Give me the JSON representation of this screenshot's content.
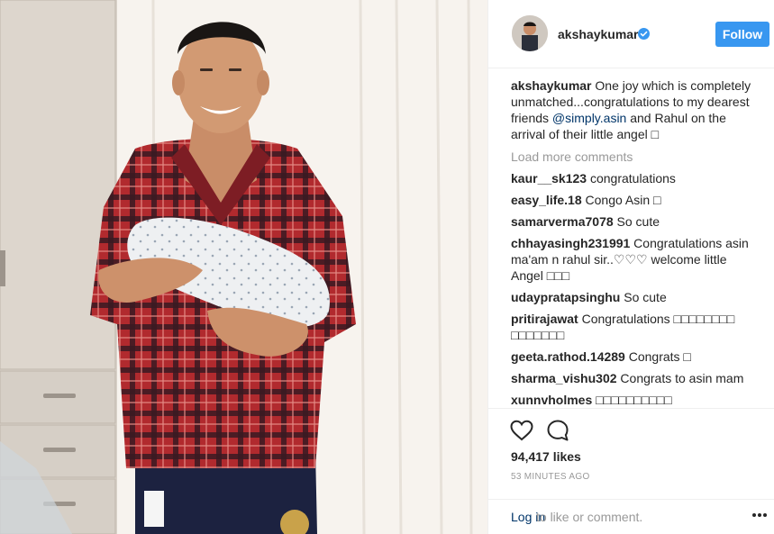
{
  "post": {
    "username": "akshaykumar",
    "follow_label": "Follow",
    "caption_user": "akshaykumar",
    "caption_part1": " One joy which is completely unmatched...congratulations to my dearest friends ",
    "caption_mention": "@simply.asin",
    "caption_part2": " and Rahul on the arrival of their little angel □",
    "load_more": "Load more comments",
    "likes": "94,417 likes",
    "timestamp": "53 MINUTES AGO",
    "login_link": "Log in",
    "login_text": " to like or comment.",
    "icons": {
      "verified": "verified-badge-icon",
      "like": "heart-icon",
      "comment": "comment-bubble-icon",
      "more": "more-options-icon"
    },
    "colors": {
      "follow_button": "#3897f0",
      "link": "#003569",
      "muted": "#999999"
    }
  },
  "comments": [
    {
      "user": "kaur__sk123",
      "text": " congratulations"
    },
    {
      "user": "easy_life.18",
      "text": " Congo Asin □"
    },
    {
      "user": "samarverma7078",
      "text": " So cute"
    },
    {
      "user": "chhayasingh231991",
      "text": " Congratulations asin ma'am n rahul sir..♡♡♡ welcome little Angel □□□"
    },
    {
      "user": "udaypratapsinghu",
      "text": " So cute"
    },
    {
      "user": "pritirajawat",
      "text": " Congratulations □□□□□□□□ □□□□□□□"
    },
    {
      "user": "geeta.rathod.14289",
      "text": " Congrats □"
    },
    {
      "user": "sharma_vishu302",
      "text": " Congrats to asin mam"
    },
    {
      "user": "xunnvholmes",
      "text": " □□□□□□□□□□"
    }
  ]
}
